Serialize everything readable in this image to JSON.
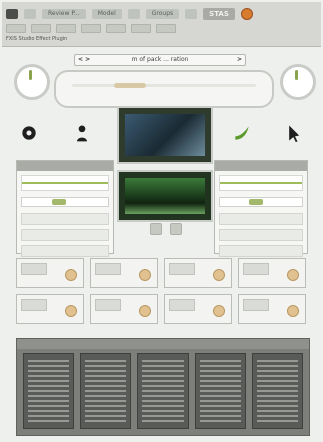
{
  "topbar": {
    "menu": [
      "",
      "",
      "Review P...",
      "Model",
      "",
      "Groups",
      "",
      "STAS"
    ],
    "row3": "FXIS Studio  Effect Plugin"
  },
  "header": {
    "nav_left": "< >",
    "breadcrumb": "m of pack ... ration",
    "nav_right": ">"
  },
  "colors": {
    "accent_green": "#9ebc5a",
    "brand_orange": "#d77b2f"
  },
  "icons": [
    "record-icon",
    "person-icon",
    "speaker-icon",
    "camera-icon",
    "leaf-icon",
    "cursor-icon"
  ],
  "photos": {
    "top": "image",
    "bottom": "image"
  },
  "panels": {
    "left_header": "",
    "right_header": ""
  },
  "bottom": {
    "header": ""
  }
}
